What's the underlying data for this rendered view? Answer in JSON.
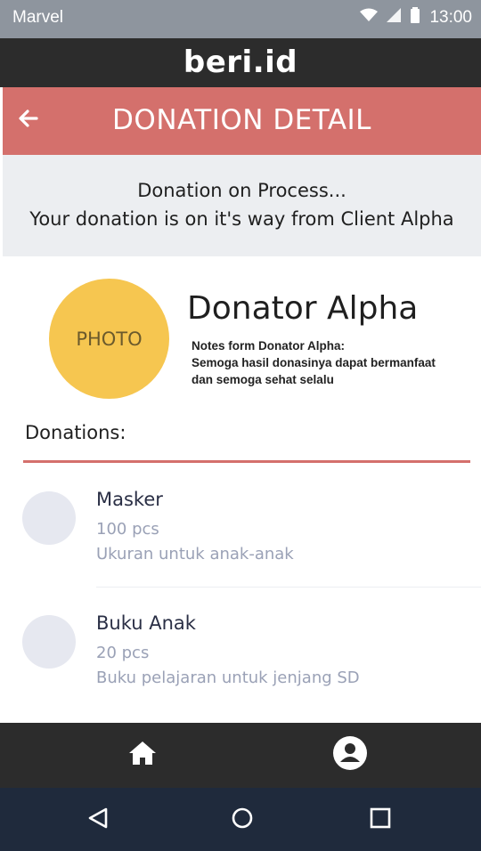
{
  "status_bar": {
    "carrier": "Marvel",
    "time": "13:00"
  },
  "app": {
    "title": "beri.id"
  },
  "page": {
    "title": "DONATION DETAIL",
    "back_icon": "arrow-left-icon"
  },
  "notice": {
    "line1": "Donation on Process...",
    "line2": "Your donation is on it's way from Client Alpha"
  },
  "donator": {
    "photo_label": "PHOTO",
    "name": "Donator Alpha",
    "notes_label": "Notes form Donator Alpha:",
    "notes_line1": "Semoga hasil donasinya dapat bermanfaat",
    "notes_line2": "dan semoga sehat selalu"
  },
  "donations": {
    "heading": "Donations:",
    "items": [
      {
        "name": "Masker",
        "qty": "100 pcs",
        "desc": "Ukuran untuk anak-anak"
      },
      {
        "name": "Buku Anak",
        "qty": "20 pcs",
        "desc": "Buku pelajaran untuk jenjang SD"
      }
    ]
  },
  "bottom_nav": {
    "items": [
      "home-icon",
      "account-icon"
    ]
  },
  "system_nav": {
    "items": [
      "back-triangle-icon",
      "home-circle-icon",
      "recents-square-icon"
    ]
  },
  "colors": {
    "status_bar": "#8e959e",
    "header": "#2c2c2c",
    "accent": "#d4706c",
    "notice_bg": "#eceef1",
    "photo": "#f6c650",
    "system_nav": "#1f2a3c"
  }
}
